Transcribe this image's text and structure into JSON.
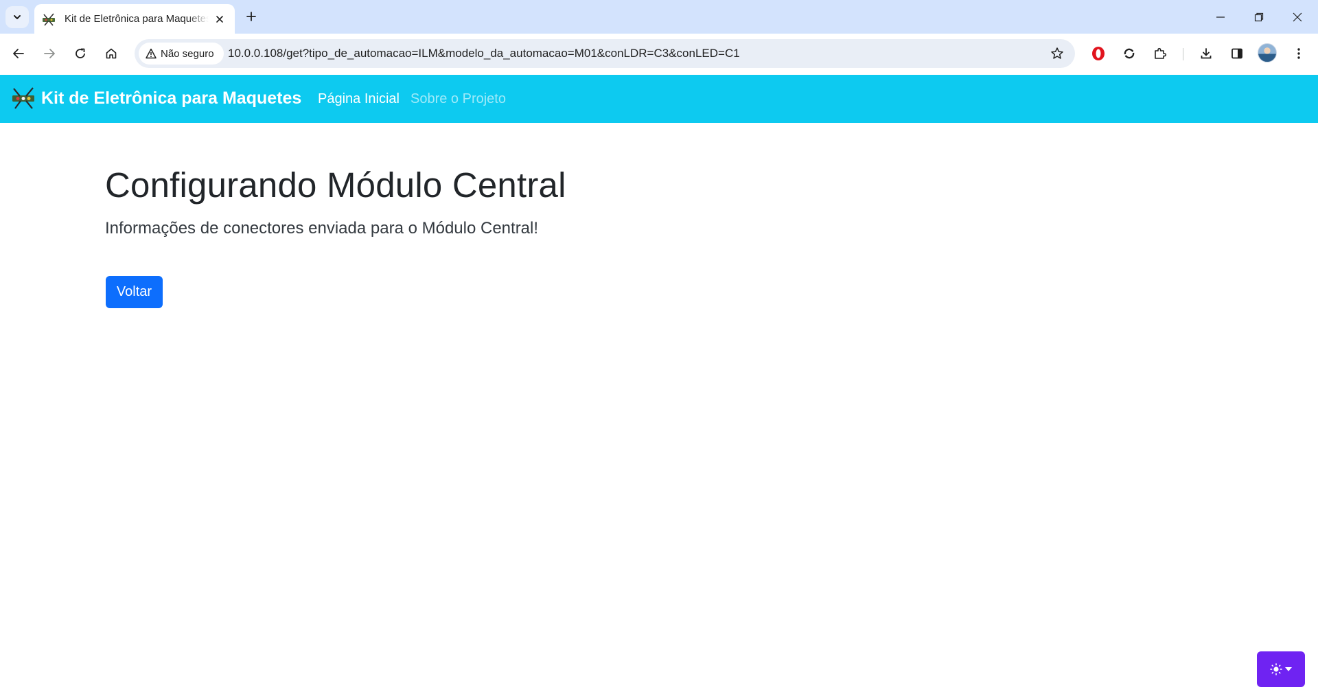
{
  "browser": {
    "tab": {
      "title": "Kit de Eletrônica para Maquetes"
    },
    "omnibox": {
      "security_label": "Não seguro",
      "url": "10.0.0.108/get?tipo_de_automacao=ILM&modelo_da_automacao=M01&conLDR=C3&conLED=C1"
    },
    "icons": {
      "tab_search": "chevron-down-icon",
      "new_tab": "plus-icon",
      "minimize": "minimize-icon",
      "restore": "restore-icon",
      "close": "close-icon",
      "back": "arrow-left-icon",
      "forward": "arrow-right-icon",
      "reload": "reload-icon",
      "home": "home-icon",
      "warning": "warning-triangle-icon",
      "bookmark": "star-icon",
      "extensions": [
        "opera-extension-icon",
        "sync-extension-icon",
        "puzzle-icon"
      ],
      "downloads": "download-icon",
      "side_panel": "side-panel-icon",
      "menu": "kebab-menu-icon"
    }
  },
  "navbar": {
    "brand": "Kit de Eletrônica para Maquetes",
    "links": [
      {
        "label": "Página Inicial",
        "active": true
      },
      {
        "label": "Sobre o Projeto",
        "active": false
      }
    ],
    "background": "#0dcaf0"
  },
  "main": {
    "title": "Configurando Módulo Central",
    "lead": "Informações de conectores enviada para o Módulo Central!",
    "back_button": "Voltar"
  },
  "theme_toggle": {
    "icon": "sun-icon",
    "caret": "caret-down-icon",
    "color": "#6f23f2"
  },
  "colors": {
    "primary": "#0d6efd",
    "tabstrip": "#d3e3fd"
  }
}
